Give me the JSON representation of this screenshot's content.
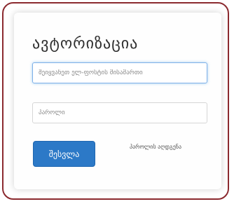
{
  "login": {
    "title": "ავტორიზაცია",
    "email_placeholder": "შეიყვანეთ ელ-ფოსტის მისამართი",
    "password_placeholder": "პაროლი",
    "submit_label": "შესვლა",
    "forgot_password_label": "პაროლის აღდგენა"
  },
  "colors": {
    "frame_border": "#8b2a2f",
    "primary_button": "#2c79c7",
    "focus_border": "#7fb0e8"
  }
}
